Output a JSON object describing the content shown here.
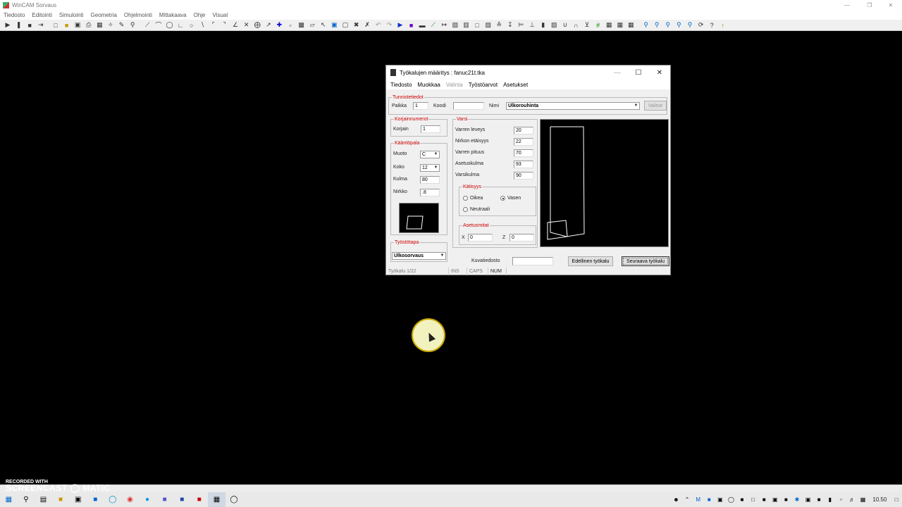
{
  "app": {
    "title": "WinCAM Sorvaus"
  },
  "menu": [
    "Tiedosto",
    "Editointi",
    "Simulointi",
    "Geometria",
    "Ohjelmointi",
    "Mittakaava",
    "Ohje",
    "Visual"
  ],
  "dialog": {
    "title": "Työkalujen määritys : fanuc21t.tka",
    "menu": [
      {
        "label": "Tiedosto",
        "enabled": true
      },
      {
        "label": "Muokkaa",
        "enabled": true
      },
      {
        "label": "Valinta",
        "enabled": false
      },
      {
        "label": "Työstöarvot",
        "enabled": true
      },
      {
        "label": "Asetukset",
        "enabled": true
      }
    ],
    "tunnistetiedot": {
      "legend": "Tunnistetiedot",
      "paikka_label": "Paikka",
      "paikka": "1",
      "koodi_label": "Koodi",
      "koodi": "",
      "nimi_label": "Nimi",
      "nimi": "Ulkorouhinta",
      "valitse_label": "Valitse"
    },
    "korjain": {
      "legend": "Korjainnumerot",
      "label": "Korjain",
      "value": "1"
    },
    "kaantopala": {
      "legend": "Kääntöpala",
      "muoto_label": "Muoto",
      "muoto": "C",
      "koko_label": "Koko",
      "koko": "12",
      "kulma_label": "Kulma",
      "kulma": "80",
      "nirkko_label": "Nirkko",
      "nirkko": ".8"
    },
    "varsi": {
      "legend": "Varsi",
      "fields": [
        {
          "label": "Varren leveys",
          "value": "20"
        },
        {
          "label": "Nirkon etäisyys",
          "value": "22"
        },
        {
          "label": "Varren pituus",
          "value": "70"
        },
        {
          "label": "Asetuskulma",
          "value": "93"
        },
        {
          "label": "Varsikulma",
          "value": "90"
        }
      ]
    },
    "katisyys": {
      "legend": "Kätisyys",
      "oikea": "Oikea",
      "vasen": "Vasen",
      "neutraali": "Neutraali",
      "selected": "Vasen"
    },
    "asetusmitat": {
      "legend": "Asetusmitat",
      "x_label": "X",
      "x": "0",
      "z_label": "Z",
      "z": "0"
    },
    "tyostotapa": {
      "legend": "Työstötapa",
      "value": "Ulkosorvaus"
    },
    "kuvatiedosto_label": "Kuvatiedosto",
    "kuvatiedosto": "",
    "prev_button": "Edellinen työkalu",
    "next_button": "Seuraava työkalu",
    "status": {
      "tool": "Työkalu 1/22",
      "ins": "INS",
      "caps": "CAPS",
      "num": "NUM"
    }
  },
  "watermark": {
    "line1": "RECORDED WITH",
    "line2": "SCREENCAST",
    "line3": "MATIC"
  },
  "clock": "10.50",
  "colors": {
    "legend": "#cc0000",
    "background": "#000000",
    "dialog": "#f0f0f0"
  }
}
